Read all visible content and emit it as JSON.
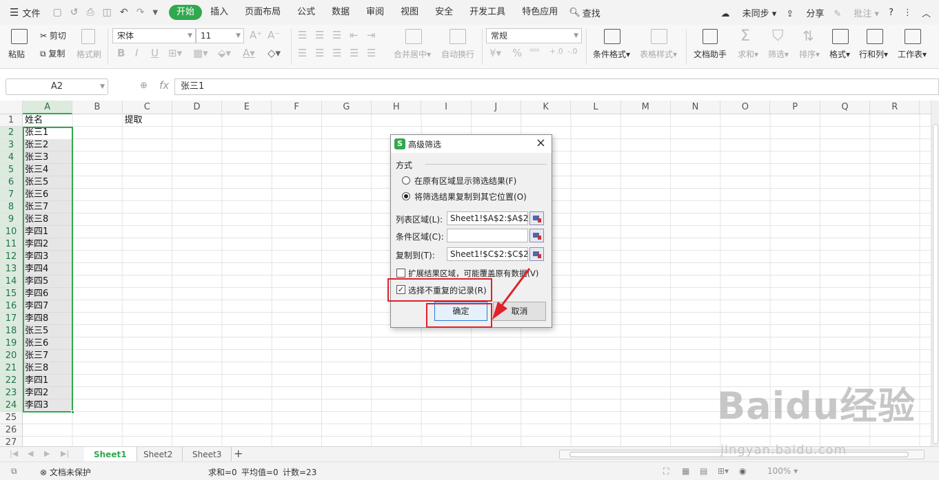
{
  "menubar": {
    "file_label": "文件",
    "tabs": [
      "开始",
      "插入",
      "页面布局",
      "公式",
      "数据",
      "审阅",
      "视图",
      "安全",
      "开发工具",
      "特色应用"
    ],
    "search_label": "查找",
    "sync_label": "未同步",
    "share_label": "分享",
    "comment_label": "批注"
  },
  "ribbon": {
    "paste": "粘贴",
    "cut": "剪切",
    "copy": "复制",
    "format_painter": "格式刷",
    "font_name": "宋体",
    "font_size": "11",
    "merge_center": "合并居中",
    "wrap_text": "自动换行",
    "number_format": "常规",
    "conditional_format": "条件格式",
    "table_style": "表格样式",
    "doc_helper": "文档助手",
    "sum": "求和",
    "filter": "筛选",
    "sort": "排序",
    "format": "格式",
    "row_col": "行和列",
    "worksheet": "工作表"
  },
  "formula_bar": {
    "name_box": "A2",
    "fx": "fx",
    "content": "张三1"
  },
  "grid": {
    "columns": [
      "A",
      "B",
      "C",
      "D",
      "E",
      "F",
      "G",
      "H",
      "I",
      "J",
      "K",
      "L",
      "M",
      "N",
      "O",
      "P",
      "Q",
      "R"
    ],
    "rows": [
      "1",
      "2",
      "3",
      "4",
      "5",
      "6",
      "7",
      "8",
      "9",
      "10",
      "11",
      "12",
      "13",
      "14",
      "15",
      "16",
      "17",
      "18",
      "19",
      "20",
      "21",
      "22",
      "23",
      "24",
      "25",
      "26",
      "27"
    ],
    "a1": "姓名",
    "c1": "提取",
    "column_a": [
      "张三1",
      "张三2",
      "张三3",
      "张三4",
      "张三5",
      "张三6",
      "张三7",
      "张三8",
      "李四1",
      "李四2",
      "李四3",
      "李四4",
      "李四5",
      "李四6",
      "李四7",
      "李四8",
      "张三5",
      "张三6",
      "张三7",
      "张三8",
      "李四1",
      "李四2",
      "李四3"
    ]
  },
  "sheets": [
    "Sheet1",
    "Sheet2",
    "Sheet3"
  ],
  "status": {
    "protect": "文档未保护",
    "sum": "求和=0",
    "avg": "平均值=0",
    "count": "计数=23",
    "zoom": "100%"
  },
  "dialog": {
    "title": "高级筛选",
    "section": "方式",
    "radio1": "在原有区域显示筛选结果(F)",
    "radio2": "将筛选结果复制到其它位置(O)",
    "list_range_label": "列表区域(L):",
    "list_range_value": "Sheet1!$A$2:$A$24",
    "criteria_label": "条件区域(C):",
    "criteria_value": "",
    "copy_to_label": "复制到(T):",
    "copy_to_value": "Sheet1!$C$2:$C$24",
    "expand_label": "扩展结果区域，可能覆盖原有数据(V)",
    "unique_label": "选择不重复的记录(R)",
    "ok": "确定",
    "cancel": "取消"
  },
  "watermark": {
    "brand": "Baidu经验",
    "url": "jingyan.baidu.com"
  },
  "colors": {
    "accent": "#31a84f",
    "annotation_red": "#e0202a"
  }
}
